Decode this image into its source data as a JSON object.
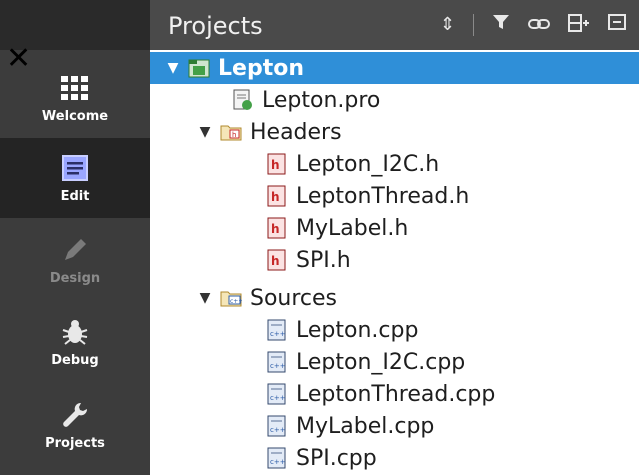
{
  "modebar": {
    "items": [
      {
        "label": "Welcome"
      },
      {
        "label": "Edit"
      },
      {
        "label": "Design"
      },
      {
        "label": "Debug"
      },
      {
        "label": "Projects"
      }
    ]
  },
  "panel": {
    "title": "Projects"
  },
  "tree": {
    "root": "Lepton",
    "pro_file": "Lepton.pro",
    "headers": {
      "label": "Headers",
      "files": [
        "Lepton_I2C.h",
        "LeptonThread.h",
        "MyLabel.h",
        "SPI.h"
      ]
    },
    "sources": {
      "label": "Sources",
      "files": [
        "Lepton.cpp",
        "Lepton_I2C.cpp",
        "LeptonThread.cpp",
        "MyLabel.cpp",
        "SPI.cpp"
      ]
    }
  }
}
